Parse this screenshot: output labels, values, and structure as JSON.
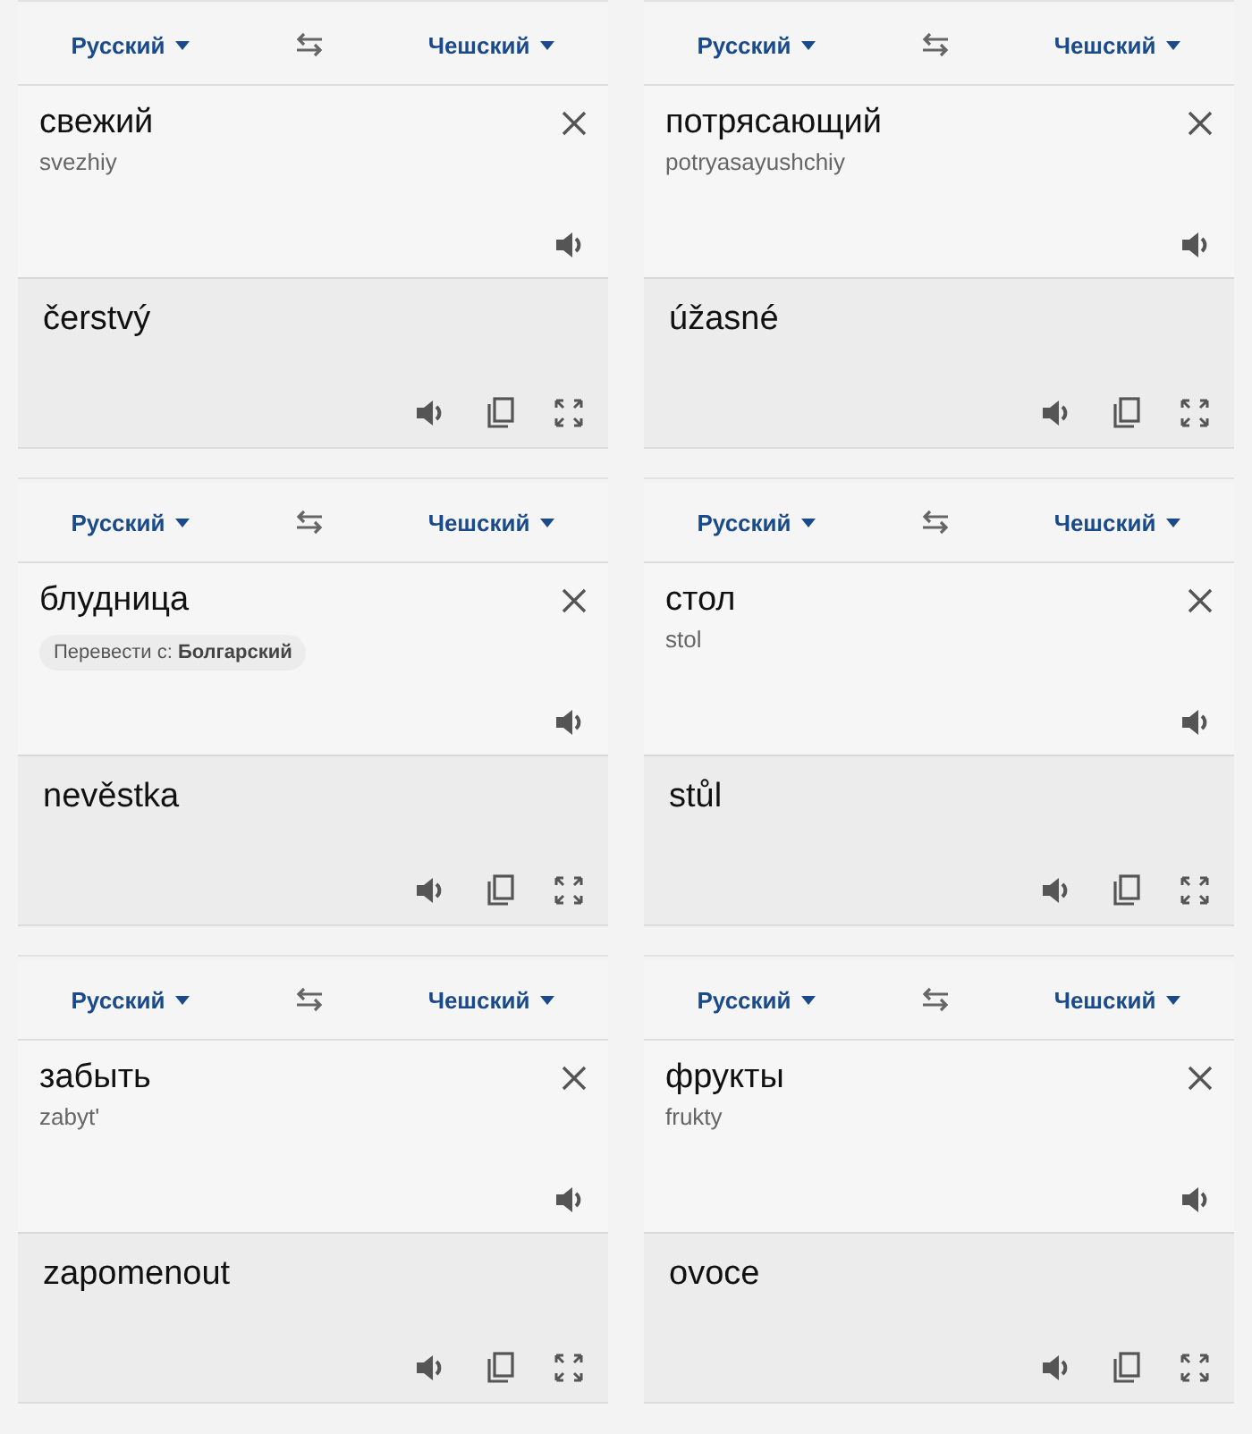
{
  "cards": [
    {
      "source_language": "Русский",
      "target_language": "Чешский",
      "input": "свежий",
      "transliteration": "svezhiy",
      "translation": "čerstvý"
    },
    {
      "source_language": "Русский",
      "target_language": "Чешский",
      "input": "потрясающий",
      "transliteration": "potryasayushchiy",
      "translation": "úžasné"
    },
    {
      "source_language": "Русский",
      "target_language": "Чешский",
      "input": "блудница",
      "detect_suggestion": "Перевести с: **Болгарский**",
      "translation": "nevěstka"
    },
    {
      "source_language": "Русский",
      "target_language": "Чешский",
      "input": "стол",
      "transliteration": "stol",
      "translation": "stůl"
    },
    {
      "source_language": "Русский",
      "target_language": "Чешский",
      "input": "забыть",
      "transliteration": "zabyt'",
      "translation": "zapomenout"
    },
    {
      "source_language": "Русский",
      "target_language": "Чешский",
      "input": "фрукты",
      "transliteration": "frukty",
      "translation": "ovoce"
    }
  ]
}
